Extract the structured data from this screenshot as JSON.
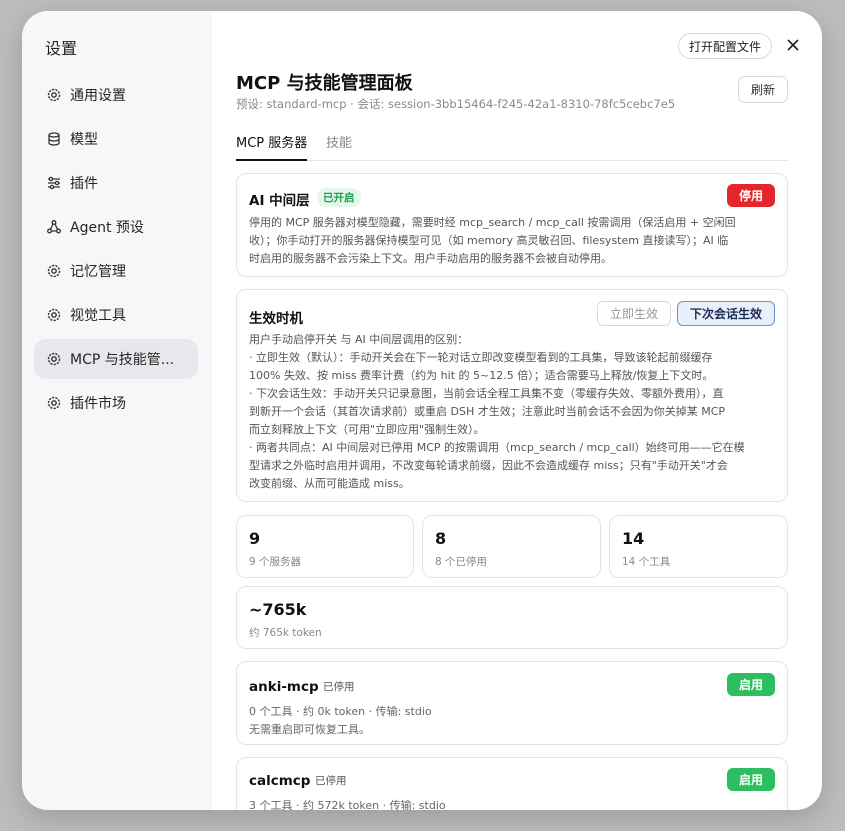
{
  "sidebar": {
    "title": "设置",
    "items": [
      {
        "label": "通用设置",
        "icon": "gear-icon"
      },
      {
        "label": "模型",
        "icon": "database-icon"
      },
      {
        "label": "插件",
        "icon": "sliders-icon"
      },
      {
        "label": "Agent 预设",
        "icon": "gear-icon"
      },
      {
        "label": "记忆管理",
        "icon": "gear-icon"
      },
      {
        "label": "视觉工具",
        "icon": "gear-icon"
      },
      {
        "label": "MCP 与技能管...",
        "icon": "gear-icon",
        "active": true
      },
      {
        "label": "插件市场",
        "icon": "gear-icon"
      }
    ]
  },
  "header": {
    "open_config_label": "打开配置文件",
    "title": "MCP 与技能管理面板",
    "subtitle": "预设: standard-mcp · 会话: session-3bb15464-f245-42a1-8310-78fc5cebc7e5",
    "refresh_label": "刷新"
  },
  "tabs": [
    {
      "label": "MCP 服务器",
      "active": true
    },
    {
      "label": "技能",
      "active": false
    }
  ],
  "ai_middleware": {
    "title": "AI 中间层",
    "status_badge": "已开启",
    "button_label": "停用",
    "description_lines": [
      "停用的 MCP 服务器对模型隐藏，需要时经 mcp_search / mcp_call 按需调用（保活启用 + 空闲回",
      "收）；你手动打开的服务器保持模型可见（如 memory 高灵敏召回、filesystem 直接读写）；AI 临",
      "时启用的服务器不会污染上下文。用户手动启用的服务器不会被自动停用。"
    ]
  },
  "effect_timing": {
    "title": "生效时机",
    "option_immediate": "立即生效",
    "option_next_session": "下次会话生效",
    "selected": "下次会话生效",
    "description_lines": [
      "用户手动启停开关 与 AI 中间层调用的区别：",
      "· 立即生效（默认）：手动开关会在下一轮对话立即改变模型看到的工具集，导致该轮起前缀缓存",
      "100% 失效、按 miss 费率计费（约为 hit 的 5~12.5 倍）；适合需要马上释放/恢复上下文时。",
      "· 下次会话生效：手动开关只记录意图，当前会话全程工具集不变（零缓存失效、零额外费用），直",
      "到新开一个会话（其首次请求前）或重启 DSH 才生效；注意此时当前会话不会因为你关掉某 MCP",
      "而立刻释放上下文（可用\"立即应用\"强制生效）。",
      "· 两者共同点：AI 中间层对已停用 MCP 的按需调用（mcp_search / mcp_call）始终可用——它在模",
      "型请求之外临时启用并调用，不改变每轮请求前缀，因此不会造成缓存 miss；只有\"手动开关\"才会",
      "改变前缀、从而可能造成 miss。"
    ]
  },
  "stats": [
    {
      "value": "9",
      "label": "9 个服务器"
    },
    {
      "value": "8",
      "label": "8 个已停用"
    },
    {
      "value": "14",
      "label": "14 个工具"
    }
  ],
  "tokens": {
    "value": "~765k",
    "label": "约 765k token"
  },
  "servers": [
    {
      "name": "anki-mcp",
      "status": "已停用",
      "button_label": "启用",
      "meta": "0 个工具 · 约 0k token · 传输: stdio",
      "note": "无需重启即可恢复工具。"
    },
    {
      "name": "calcmcp",
      "status": "已停用",
      "button_label": "启用",
      "meta": "3 个工具 · 约 572k token · 传输: stdio"
    }
  ],
  "colors": {
    "danger": "#e5262a",
    "success": "#2dbe62",
    "accent_selected": "#e9effb"
  }
}
